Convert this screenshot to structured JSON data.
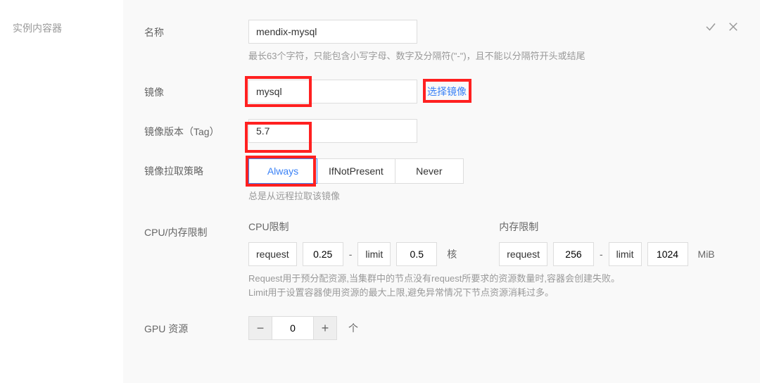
{
  "sidebar": {
    "label": "实例内容器"
  },
  "form": {
    "name": {
      "label": "名称",
      "value": "mendix-mysql",
      "hint": "最长63个字符，只能包含小写字母、数字及分隔符(\"-\")，且不能以分隔符开头或结尾"
    },
    "image": {
      "label": "镜像",
      "value": "mysql",
      "select_link": "选择镜像"
    },
    "tag": {
      "label": "镜像版本（Tag）",
      "value": "5.7"
    },
    "pullPolicy": {
      "label": "镜像拉取策略",
      "options": [
        "Always",
        "IfNotPresent",
        "Never"
      ],
      "selected": "Always",
      "hint": "总是从远程拉取该镜像"
    },
    "cpuMem": {
      "label": "CPU/内存限制",
      "cpu": {
        "title": "CPU限制",
        "request_label": "request",
        "request_value": "0.25",
        "limit_label": "limit",
        "limit_value": "0.5",
        "unit": "核"
      },
      "mem": {
        "title": "内存限制",
        "request_label": "request",
        "request_value": "256",
        "limit_label": "limit",
        "limit_value": "1024",
        "unit": "MiB"
      },
      "hint": "Request用于预分配资源,当集群中的节点没有request所要求的资源数量时,容器会创建失败。\nLimit用于设置容器使用资源的最大上限,避免异常情况下节点资源消耗过多。"
    },
    "gpu": {
      "label": "GPU 资源",
      "value": "0",
      "unit": "个"
    }
  },
  "icons": {
    "confirm": "check",
    "cancel": "close"
  }
}
